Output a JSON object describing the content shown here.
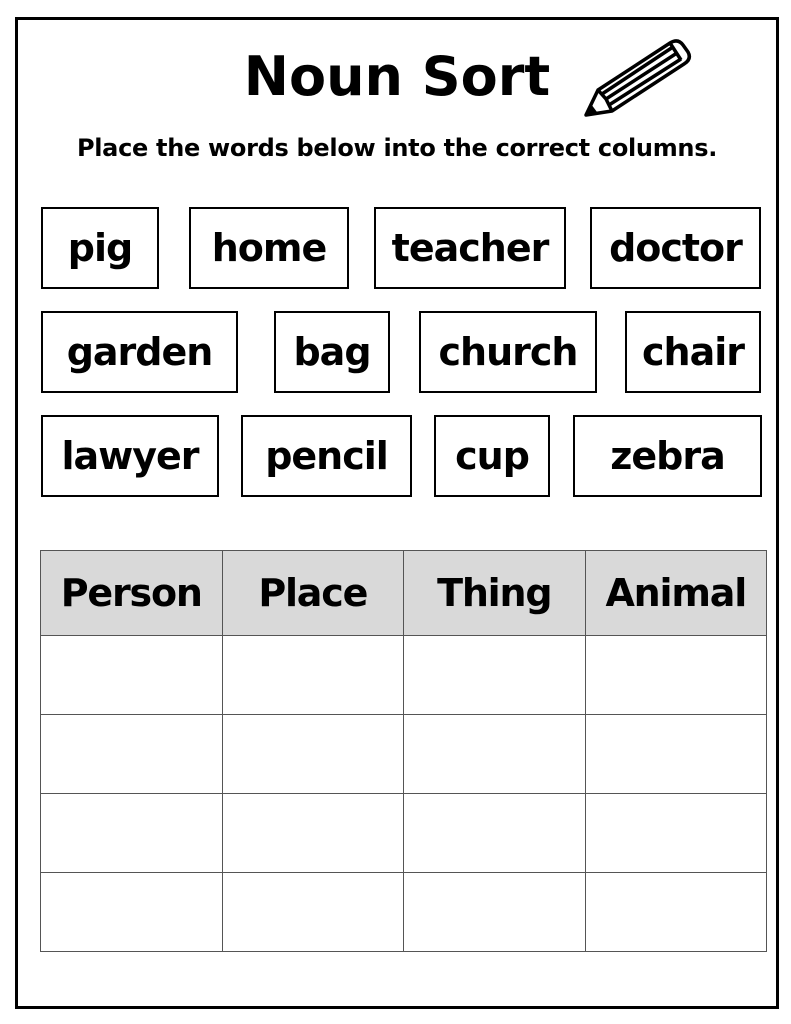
{
  "worksheet": {
    "title": "Noun Sort",
    "instructions": "Place the words below into the correct columns.",
    "decoration_icon": "pencil-icon",
    "word_bank": [
      [
        "pig",
        "home",
        "teacher",
        "doctor"
      ],
      [
        "garden",
        "bag",
        "church",
        "chair"
      ],
      [
        "lawyer",
        "pencil",
        "cup",
        "zebra"
      ]
    ],
    "table": {
      "headers": [
        "Person",
        "Place",
        "Thing",
        "Animal"
      ],
      "rows": [
        [
          "",
          "",
          "",
          ""
        ],
        [
          "",
          "",
          "",
          ""
        ],
        [
          "",
          "",
          "",
          ""
        ],
        [
          "",
          "",
          "",
          ""
        ]
      ],
      "header_bg": "#d9d9d9"
    }
  }
}
